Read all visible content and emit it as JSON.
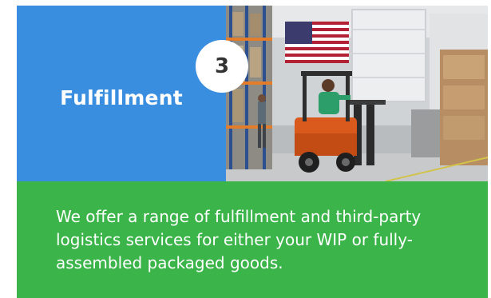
{
  "card": {
    "step_number": "3",
    "title": "Fulfillment",
    "description": "We offer a range of fulfillment and third-party logistics services for either your WIP or fully-assembled packaged goods.",
    "photo_icon": "warehouse-forklift-photo",
    "colors": {
      "blue_panel": "#3a8ee0",
      "green_panel": "#3bb54a",
      "badge_bg": "#ffffff",
      "badge_text": "#333333",
      "text": "#ffffff"
    }
  }
}
